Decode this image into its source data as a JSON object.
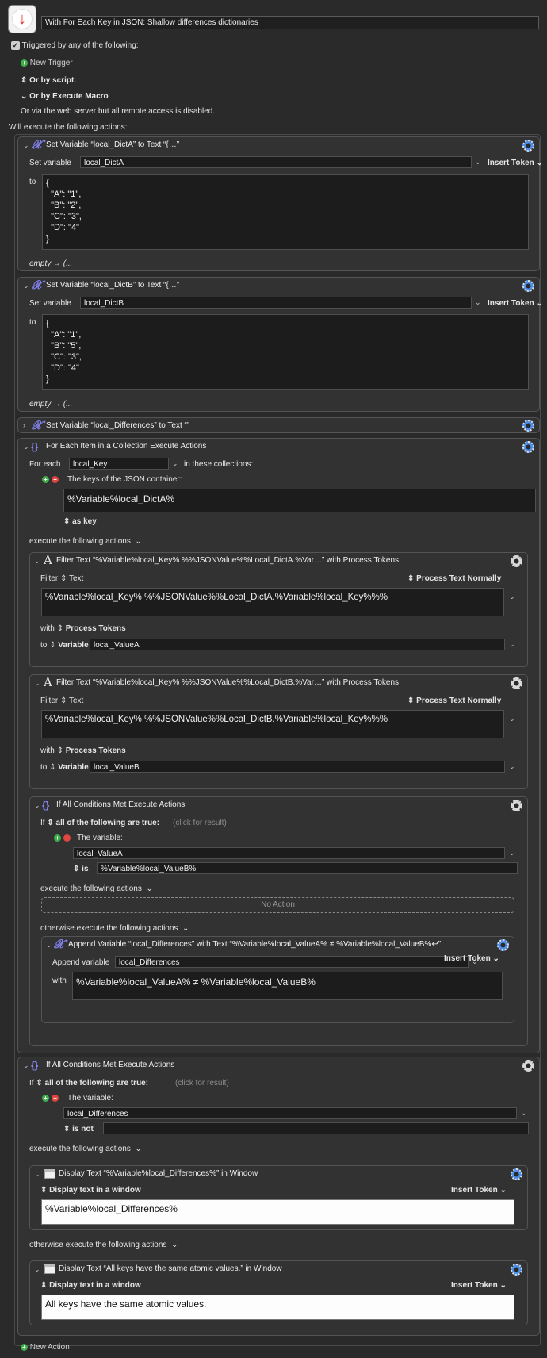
{
  "macro": {
    "title": "With For Each Key in JSON: Shallow differences dictionaries",
    "triggered_by": "Triggered by any of the following:",
    "new_trigger": "New Trigger",
    "or_by_script": "Or by script.",
    "or_by_execute_macro": "Or by Execute Macro",
    "web_server_note": "Or via the web server but all remote access is disabled.",
    "will_execute": "Will execute the following actions:",
    "new_action": "New Action"
  },
  "common": {
    "insert_token": "Insert Token",
    "set_variable": "Set variable",
    "to": "to",
    "empty_arrow": "empty → (...",
    "execute_following": "execute the following actions",
    "otherwise_execute": "otherwise execute the following actions",
    "all_following_true": "all of the following are true:",
    "click_for_result": "(click for result)",
    "the_variable": "The variable:",
    "filter": "Filter",
    "text": "Text",
    "process_text_normally": "Process Text Normally",
    "with": "with",
    "process_tokens": "Process Tokens",
    "variable": "Variable",
    "if": "If",
    "display_text_in_window": "Display text in a window",
    "no_action": "No Action",
    "append_variable": "Append variable"
  },
  "action1": {
    "title": "Set Variable “local_DictA” to Text “{…”",
    "variable": "local_DictA",
    "value": "{\n  \"A\": \"1\",\n  \"B\": \"2\",\n  \"C\": \"3\",\n  \"D\": \"4\"\n}"
  },
  "action2": {
    "title": "Set Variable “local_DictB” to Text “{…”",
    "variable": "local_DictB",
    "value": "{\n  \"A\": \"1\",\n  \"B\": \"5\",\n  \"C\": \"3\",\n  \"D\": \"4\"\n}"
  },
  "action3": {
    "title": "Set Variable “local_Differences” to Text “”"
  },
  "foreach": {
    "title": "For Each Item in a Collection Execute Actions",
    "for_each": "For each",
    "variable": "local_Key",
    "in_collections": "in these collections:",
    "keys_of": "The keys of the JSON container:",
    "container": "%Variable%local_DictA%",
    "as_key": "as key",
    "filterA": {
      "title": "Filter Text “%Variable%local_Key% %%JSONValue%%Local_DictA.%Var…” with Process Tokens",
      "text": "%Variable%local_Key% %%JSONValue%%Local_DictA.%Variable%local_Key%%%",
      "dest": "local_ValueA"
    },
    "filterB": {
      "title": "Filter Text “%Variable%local_Key% %%JSONValue%%Local_DictB.%Var…” with Process Tokens",
      "text": "%Variable%local_Key% %%JSONValue%%Local_DictB.%Variable%local_Key%%%",
      "dest": "local_ValueB"
    },
    "if1": {
      "title": "If All Conditions Met Execute Actions",
      "var": "local_ValueA",
      "op": "is",
      "value": "%Variable%local_ValueB%",
      "append": {
        "title": "Append Variable “local_Differences” with Text “%Variable%local_ValueA% ≠ %Variable%local_ValueB%↩”",
        "variable": "local_Differences",
        "text": "%Variable%local_ValueA% ≠ %Variable%local_ValueB%"
      }
    }
  },
  "if2": {
    "title": "If All Conditions Met Execute Actions",
    "var": "local_Differences",
    "op": "is not",
    "display1": {
      "title": "Display Text “%Variable%local_Differences%” in Window",
      "text": "%Variable%local_Differences%"
    },
    "display2": {
      "title": "Display Text “All keys have the same atomic values.” in Window",
      "text": "All keys have the same atomic values."
    }
  }
}
